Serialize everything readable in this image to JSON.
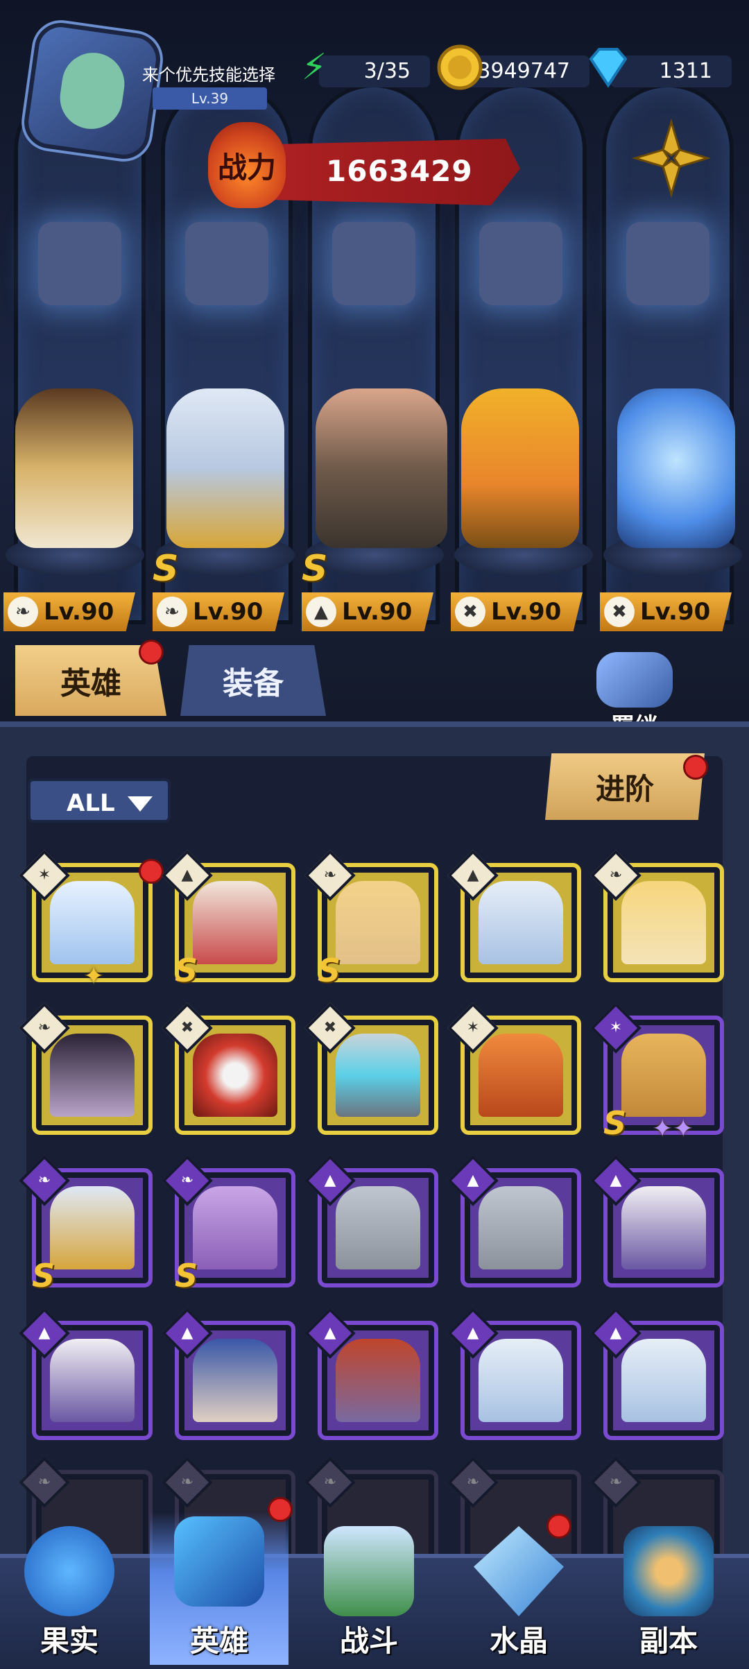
{
  "player": {
    "name": "来个优先技能选择",
    "level": "Lv.39"
  },
  "resources": [
    {
      "icon": "energy-icon",
      "value": "3/35"
    },
    {
      "icon": "gold-coin-icon",
      "value": "3949747"
    },
    {
      "icon": "diamond-icon",
      "value": "1311"
    }
  ],
  "power": {
    "label": "战力",
    "value": "1663429"
  },
  "team": [
    {
      "level": "Lv.90",
      "class_icon": "wing-icon",
      "s_rank": false
    },
    {
      "level": "Lv.90",
      "class_icon": "wing-icon",
      "s_rank": true
    },
    {
      "level": "Lv.90",
      "class_icon": "mage-hat-icon",
      "s_rank": true
    },
    {
      "level": "Lv.90",
      "class_icon": "wrench-icon",
      "s_rank": false
    },
    {
      "level": "Lv.90",
      "class_icon": "wrench-icon",
      "s_rank": false
    }
  ],
  "tabs": {
    "heroes": "英雄",
    "equipment": "装备",
    "bond": "羁绊"
  },
  "filter": {
    "label": "ALL"
  },
  "advance_button": "进阶",
  "roster_colors": {
    "gold": "#e8cf42",
    "purple": "#7a4ad1",
    "dark": "#3a3550"
  },
  "bottom_nav": [
    {
      "label": "果实"
    },
    {
      "label": "英雄"
    },
    {
      "label": "战斗"
    },
    {
      "label": "水晶"
    },
    {
      "label": "副本"
    }
  ]
}
